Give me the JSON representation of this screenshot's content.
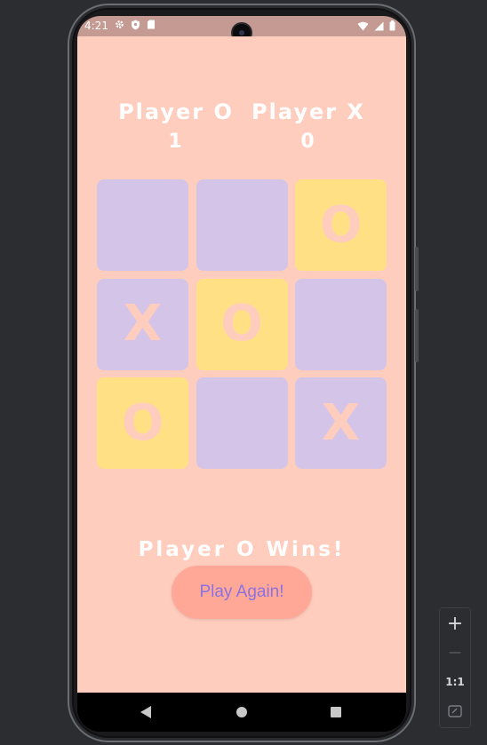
{
  "status_bar": {
    "time": "4:21",
    "left_icons": [
      "gear-icon",
      "shield-icon",
      "sd-card-icon"
    ],
    "right_icons": [
      "wifi-icon",
      "signal-icon",
      "battery-icon"
    ]
  },
  "scoreboard": {
    "player_o": {
      "label": "Player O",
      "score": "1"
    },
    "player_x": {
      "label": "Player X",
      "score": "0"
    }
  },
  "board": {
    "cells": [
      "",
      "",
      "O",
      "X",
      "O",
      "",
      "O",
      "",
      "X"
    ]
  },
  "result_text": "Player O Wins!",
  "play_again_label": "Play Again!",
  "colors": {
    "background": "#ffcdbd",
    "empty_cell": "#d4c5e8",
    "o_cell": "#ffe085",
    "mark": "#ffcdbd",
    "button_bg": "#ffa898",
    "button_text": "#8b72df"
  },
  "zoom_controls": {
    "zoom_in": "+",
    "zoom_out": "—",
    "actual_size": "1:1"
  }
}
